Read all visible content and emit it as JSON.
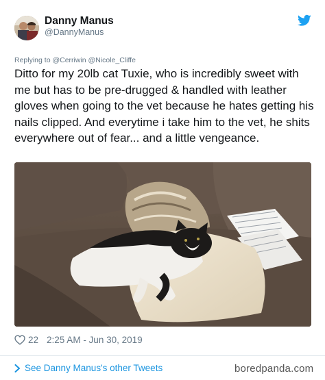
{
  "author": {
    "name": "Danny Manus",
    "handle": "@DannyManus"
  },
  "reply": {
    "prefix": "Replying to",
    "mentions": "@Cerriwin @Nicole_Cliffe"
  },
  "tweet": {
    "text": "Ditto for my 20lb cat Tuxie, who is incredibly sweet with me but has to be pre-drugged & handled with leather gloves when going to the vet because he hates getting his nails clipped. And everytime i take him to the vet, he shits everywhere out of fear... and a little vengeance."
  },
  "meta": {
    "like_count": "22",
    "timestamp": "2:25 AM - Jun 30, 2019"
  },
  "footer": {
    "see_more": "See Danny Manus's other Tweets"
  },
  "watermark": {
    "text": "boredpanda.com"
  },
  "icons": {
    "brand": "twitter-bird-icon",
    "like": "heart-icon",
    "more": "chevron-right-icon"
  },
  "colors": {
    "twitter_blue": "#1da1f2",
    "link_blue": "#1b95e0",
    "secondary_text": "#657786"
  }
}
